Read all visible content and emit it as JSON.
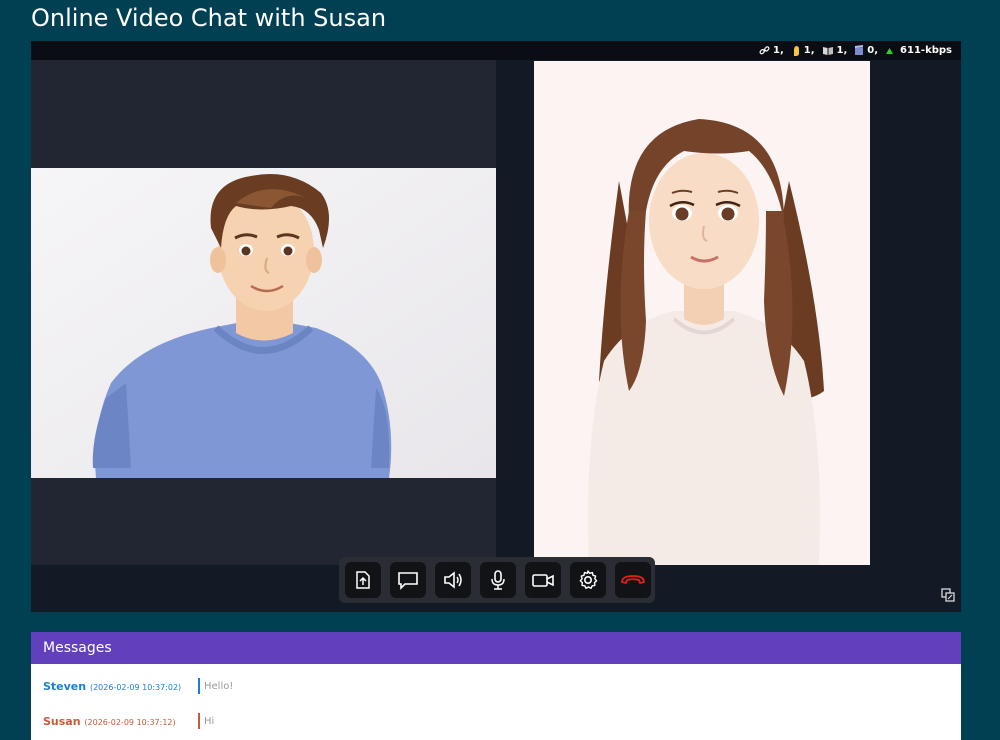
{
  "page": {
    "title": "Online Video Chat with Susan"
  },
  "status": {
    "links": "1,",
    "hands": "1,",
    "books": "1,",
    "clips": "0,",
    "bitrate": "611-kbps"
  },
  "video": {
    "local_user": "Steven",
    "remote_user": "Susan"
  },
  "toolbar": {
    "buttons": [
      "upload-file",
      "chat",
      "speaker",
      "microphone",
      "camera",
      "settings",
      "hang-up"
    ]
  },
  "messages": {
    "header": "Messages",
    "items": [
      {
        "sender": "Steven",
        "time": "(2026-02-09 10:37:02)",
        "text": "Hello!",
        "color": "#1a7fd6"
      },
      {
        "sender": "Susan",
        "time": "(2026-02-09 10:37:12)",
        "text": "Hi",
        "color": "#c75a38"
      }
    ]
  },
  "colors": {
    "background": "#013f52",
    "header_purple": "#6240bd",
    "hangup_red": "#e0201b",
    "up_arrow_green": "#2bd42b"
  }
}
